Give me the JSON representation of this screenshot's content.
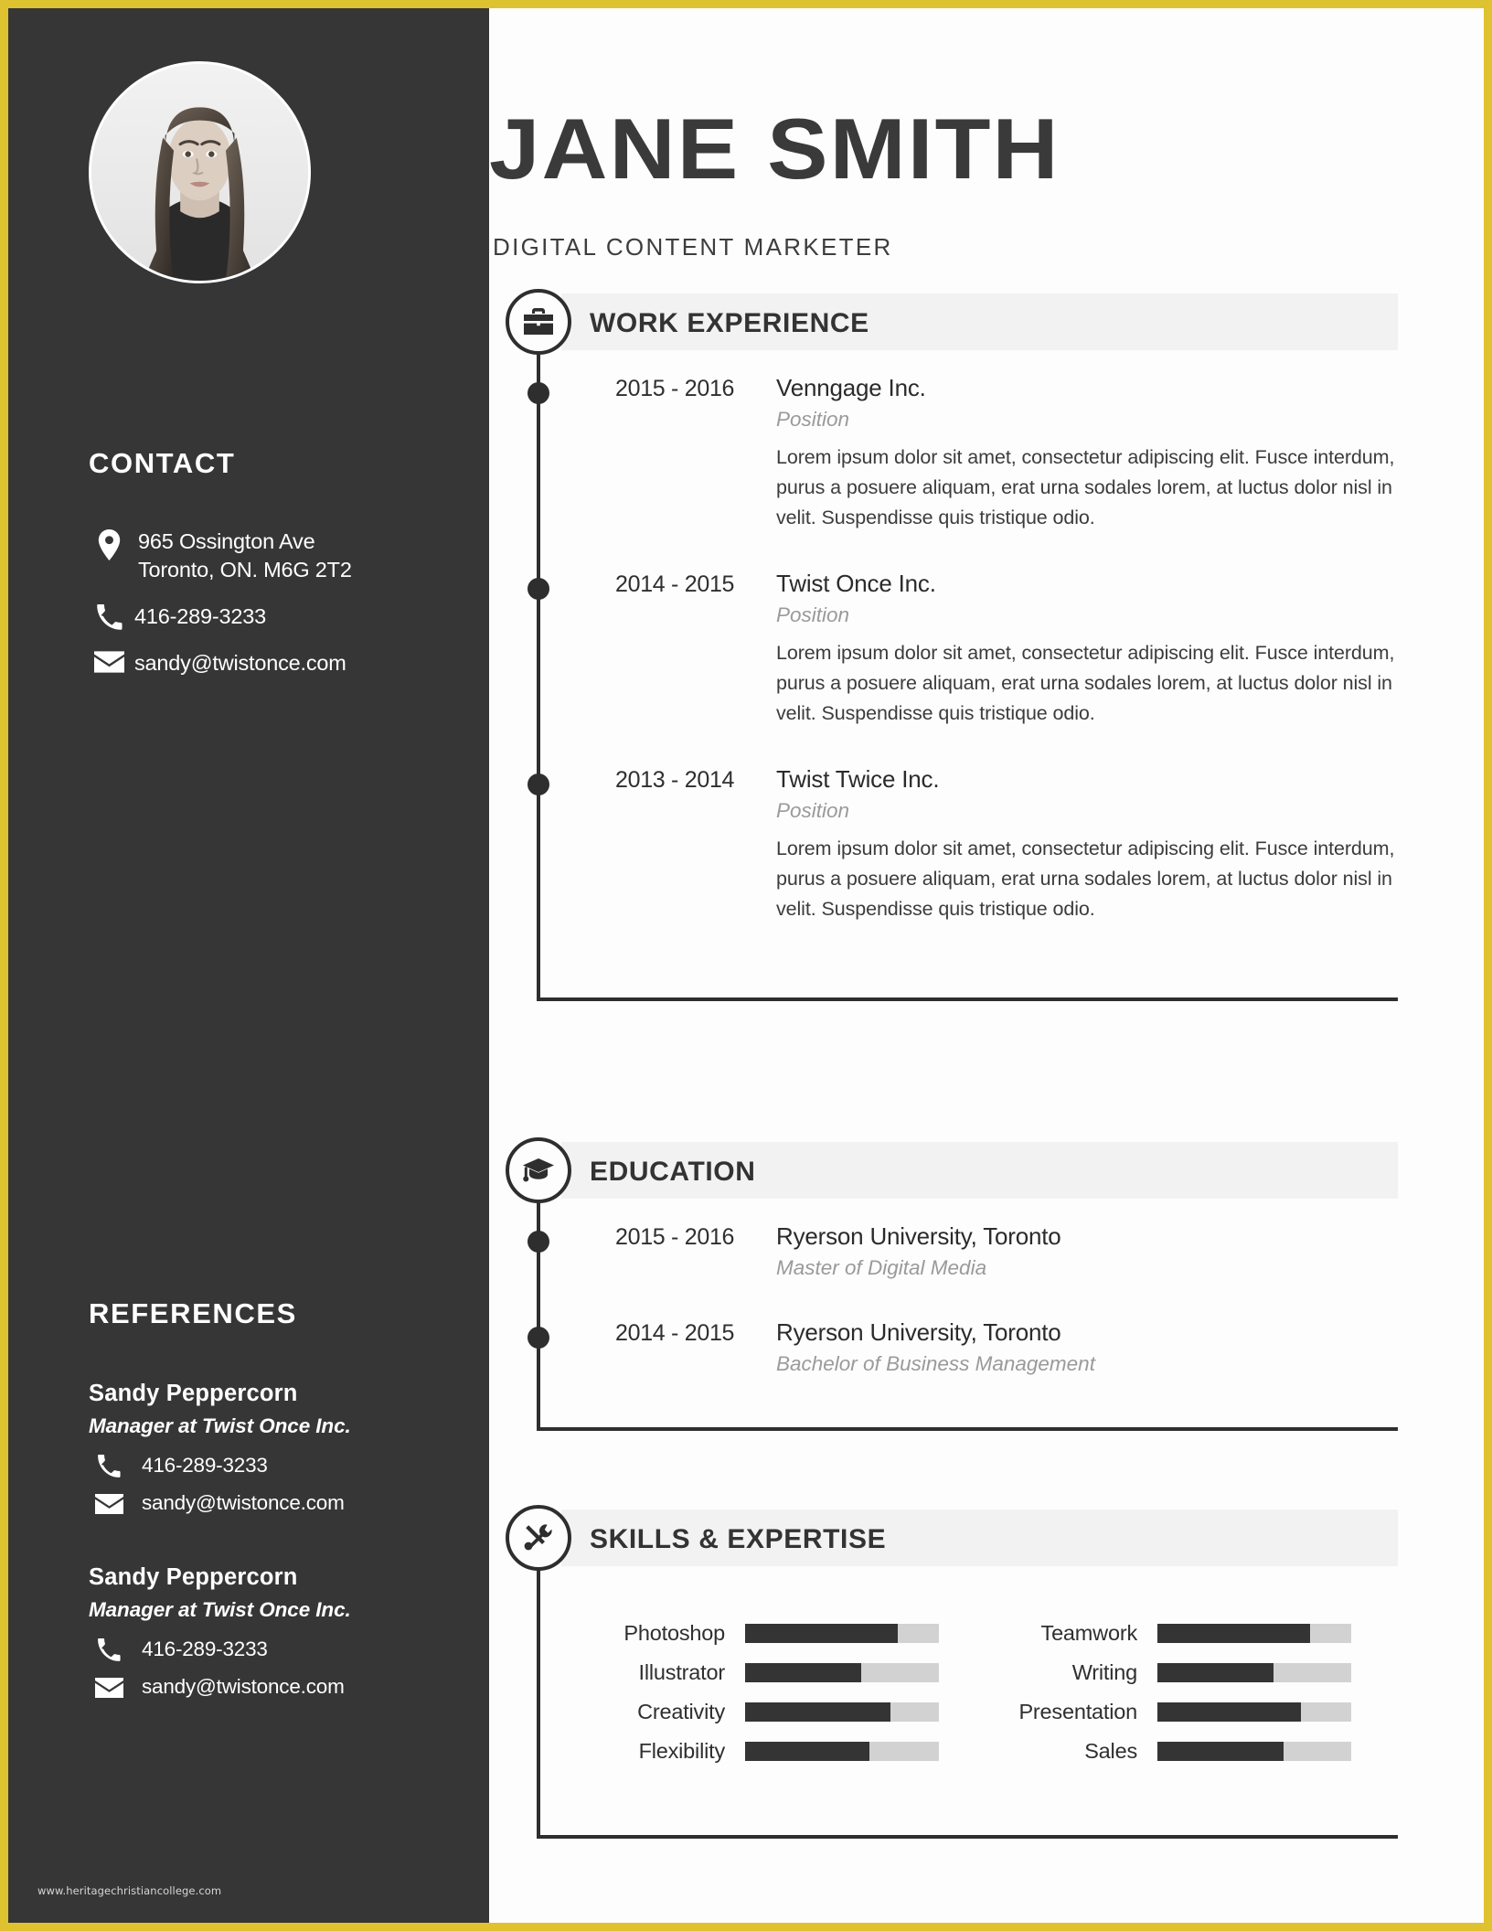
{
  "theme": {
    "border_color": "#dfc22f",
    "sidebar_bg": "#363636",
    "accent_dark": "#2e2e2e",
    "band_bg": "#f2f2f2",
    "muted_text": "#9a9a9a"
  },
  "header": {
    "name": "JANE SMITH",
    "job_title": "DIGITAL CONTENT MARKETER"
  },
  "sidebar": {
    "contact": {
      "heading": "CONTACT",
      "address_line1": "965 Ossington Ave",
      "address_line2": "Toronto, ON. M6G 2T2",
      "phone": "416-289-3233",
      "email": "sandy@twistonce.com"
    },
    "references": {
      "heading": "REFERENCES",
      "items": [
        {
          "name": "Sandy Peppercorn",
          "role": "Manager at Twist Once Inc.",
          "phone": "416-289-3233",
          "email": "sandy@twistonce.com"
        },
        {
          "name": "Sandy Peppercorn",
          "role": "Manager at Twist Once Inc.",
          "phone": "416-289-3233",
          "email": "sandy@twistonce.com"
        }
      ]
    },
    "watermark": "www.heritagechristiancollege.com"
  },
  "sections": {
    "work": {
      "title": "WORK EXPERIENCE",
      "icon": "briefcase-icon",
      "entries": [
        {
          "years": "2015 - 2016",
          "org": "Venngage Inc.",
          "role": "Position",
          "desc": "Lorem ipsum dolor sit amet, consectetur adipiscing elit. Fusce interdum, purus a posuere aliquam, erat urna sodales lorem, at luctus dolor nisl in velit. Suspendisse quis tristique odio."
        },
        {
          "years": "2014 - 2015",
          "org": "Twist Once Inc.",
          "role": "Position",
          "desc": "Lorem ipsum dolor sit amet, consectetur adipiscing elit. Fusce interdum, purus a posuere aliquam, erat urna sodales lorem, at luctus dolor nisl in velit. Suspendisse quis tristique odio."
        },
        {
          "years": "2013 - 2014",
          "org": "Twist Twice Inc.",
          "role": "Position",
          "desc": "Lorem ipsum dolor sit amet, consectetur adipiscing elit. Fusce interdum, purus a posuere aliquam, erat urna sodales lorem, at luctus dolor nisl in velit. Suspendisse quis tristique odio."
        }
      ]
    },
    "education": {
      "title": "EDUCATION",
      "icon": "graduation-cap-icon",
      "entries": [
        {
          "years": "2015 - 2016",
          "org": "Ryerson University, Toronto",
          "role": "Master of Digital Media"
        },
        {
          "years": "2014 - 2015",
          "org": "Ryerson University, Toronto",
          "role": "Bachelor of Business Management"
        }
      ]
    },
    "skills": {
      "title": "SKILLS & EXPERTISE",
      "icon": "tools-icon",
      "left_column": [
        {
          "label": "Photoshop",
          "value": 79
        },
        {
          "label": "Illustrator",
          "value": 60
        },
        {
          "label": "Creativity",
          "value": 75
        },
        {
          "label": "Flexibility",
          "value": 64
        }
      ],
      "right_column": [
        {
          "label": "Teamwork",
          "value": 79
        },
        {
          "label": "Writing",
          "value": 60
        },
        {
          "label": "Presentation",
          "value": 74
        },
        {
          "label": "Sales",
          "value": 65
        }
      ]
    }
  }
}
